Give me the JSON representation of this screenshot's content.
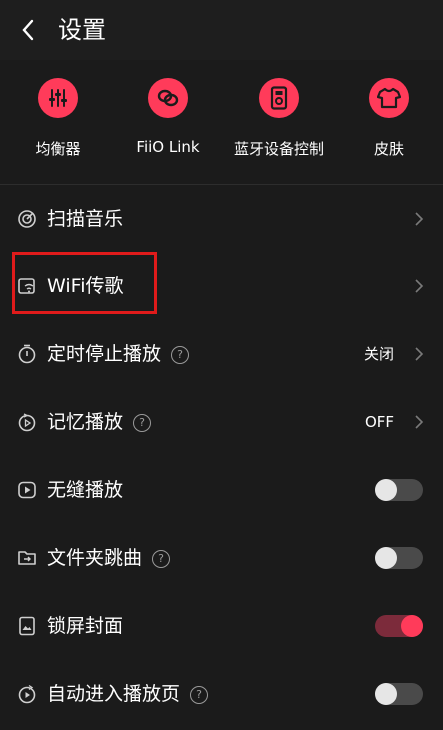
{
  "header": {
    "title": "设置"
  },
  "quick_actions": [
    {
      "label": "均衡器",
      "icon": "equalizer-icon"
    },
    {
      "label": "FiiO Link",
      "icon": "link-icon"
    },
    {
      "label": "蓝牙设备控制",
      "icon": "device-icon"
    },
    {
      "label": "皮肤",
      "icon": "tshirt-icon"
    }
  ],
  "settings": {
    "scan_music": {
      "label": "扫描音乐"
    },
    "wifi_transfer": {
      "label": "WiFi传歌"
    },
    "sleep_timer": {
      "label": "定时停止播放",
      "value": "关闭"
    },
    "resume_playback": {
      "label": "记忆播放",
      "value": "OFF"
    },
    "gapless": {
      "label": "无缝播放",
      "enabled": false
    },
    "folder_skip": {
      "label": "文件夹跳曲",
      "enabled": false
    },
    "lockscreen_cover": {
      "label": "锁屏封面",
      "enabled": true
    },
    "auto_play_page": {
      "label": "自动进入播放页",
      "enabled": false
    }
  },
  "colors": {
    "accent": "#ff3b5a",
    "background": "#1b1b1b"
  }
}
